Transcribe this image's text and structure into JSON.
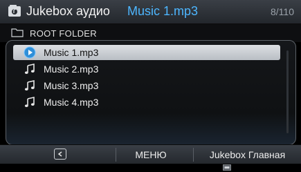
{
  "header": {
    "app_title": "Jukebox аудио",
    "track_title": "Music 1.mp3",
    "counter": "8/110"
  },
  "folder": {
    "name": "ROOT FOLDER"
  },
  "tracks": [
    {
      "label": "Music 1.mp3",
      "state": "playing"
    },
    {
      "label": "Music 2.mp3",
      "state": "idle"
    },
    {
      "label": "Music 3.mp3",
      "state": "idle"
    },
    {
      "label": "Music 4.mp3",
      "state": "idle"
    }
  ],
  "footer": {
    "menu_label": "МЕНЮ",
    "home_label": "Jukebox Главная"
  },
  "icons": {
    "app": "jukebox-icon",
    "folder": "folder-icon",
    "play": "play-circle-icon",
    "note": "music-note-icon",
    "back": "back-icon"
  },
  "colors": {
    "accent": "#4db6ff",
    "selection": "#cfd3d7"
  }
}
